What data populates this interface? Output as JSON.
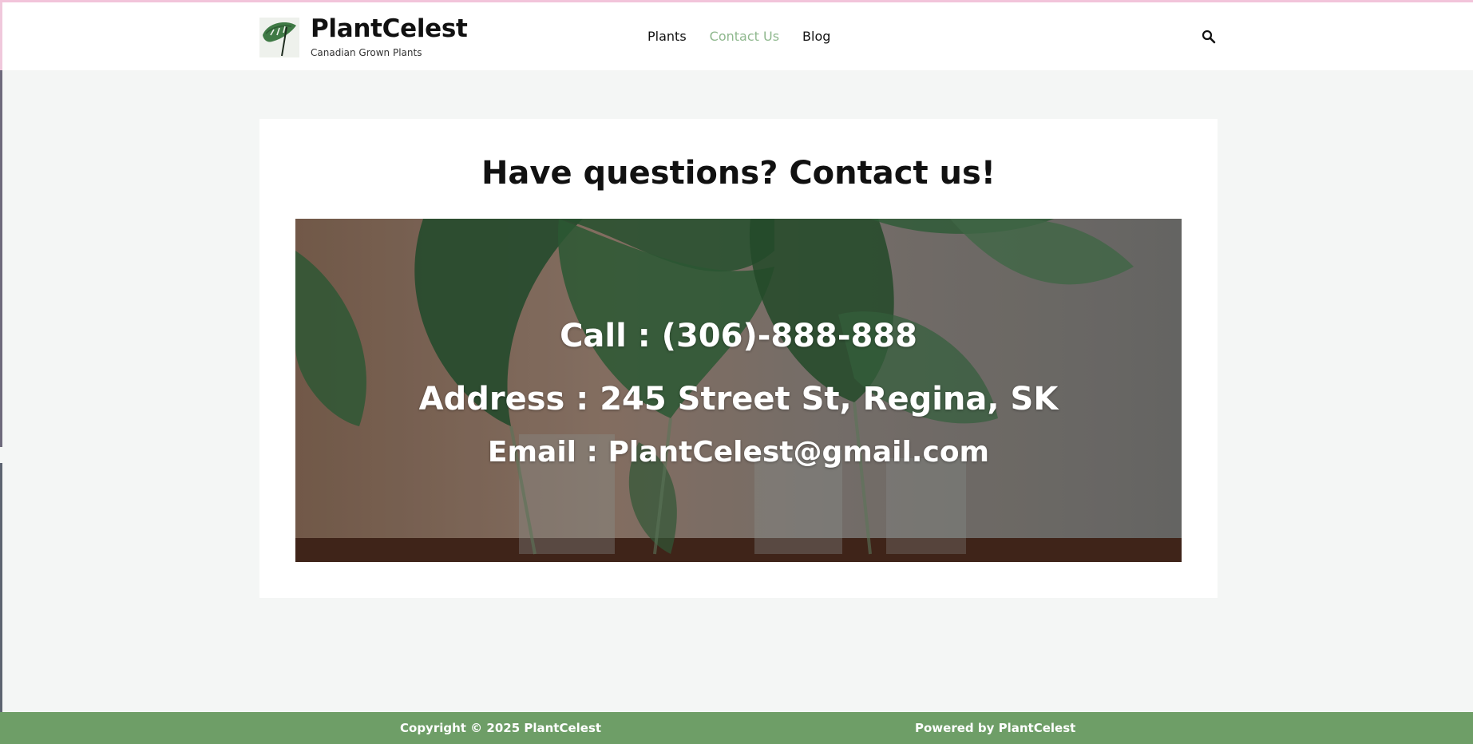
{
  "site": {
    "title": "PlantCelest",
    "tagline": "Canadian Grown Plants",
    "logo_icon": "monstera-leaf-icon"
  },
  "nav": {
    "items": [
      {
        "label": "Plants",
        "active": false
      },
      {
        "label": "Contact Us",
        "active": true
      },
      {
        "label": "Blog",
        "active": false
      }
    ],
    "search_icon": "search-icon"
  },
  "main": {
    "heading": "Have questions? Contact us!",
    "contact": {
      "call": "Call : (306)-888-888",
      "address": "Address : 245 Street St, Regina, SK",
      "email": "Email : PlantCelest@gmail.com"
    }
  },
  "footer": {
    "copyright": "Copyright © 2025 PlantCelest",
    "powered_by": "Powered by PlantCelest"
  },
  "colors": {
    "nav_active": "#8fb88e",
    "footer_bg": "#6e9e67",
    "page_bg": "#f4f6f5",
    "top_accent": "#f2c4da"
  }
}
